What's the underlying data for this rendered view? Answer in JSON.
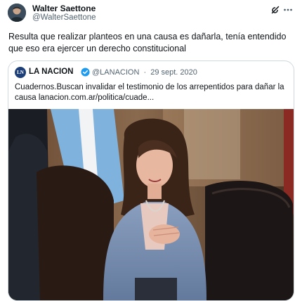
{
  "author": {
    "name": "Walter Saettone",
    "handle": "@WalterSaettone"
  },
  "actions": {
    "grok_icon": "grok-icon",
    "more_icon": "more-icon"
  },
  "tweet": {
    "text": "Resulta que realizar planteos en una causa es dañarla, tenía entendido que eso era ejercer un derecho constitucional"
  },
  "quoted": {
    "logo_text": "LN",
    "name": "LA NACION",
    "verified": true,
    "handle": "@LANACION",
    "separator": "·",
    "date": "29 sept. 2020",
    "text": "Cuadernos.Buscan invalidar el testimonio de los arrepentidos para dañar la causa lanacion.com.ar/politica/cuade..."
  },
  "colors": {
    "text": "#0f1419",
    "secondary": "#536471",
    "border": "#cfd9de",
    "verified": "#1d9bf0"
  }
}
